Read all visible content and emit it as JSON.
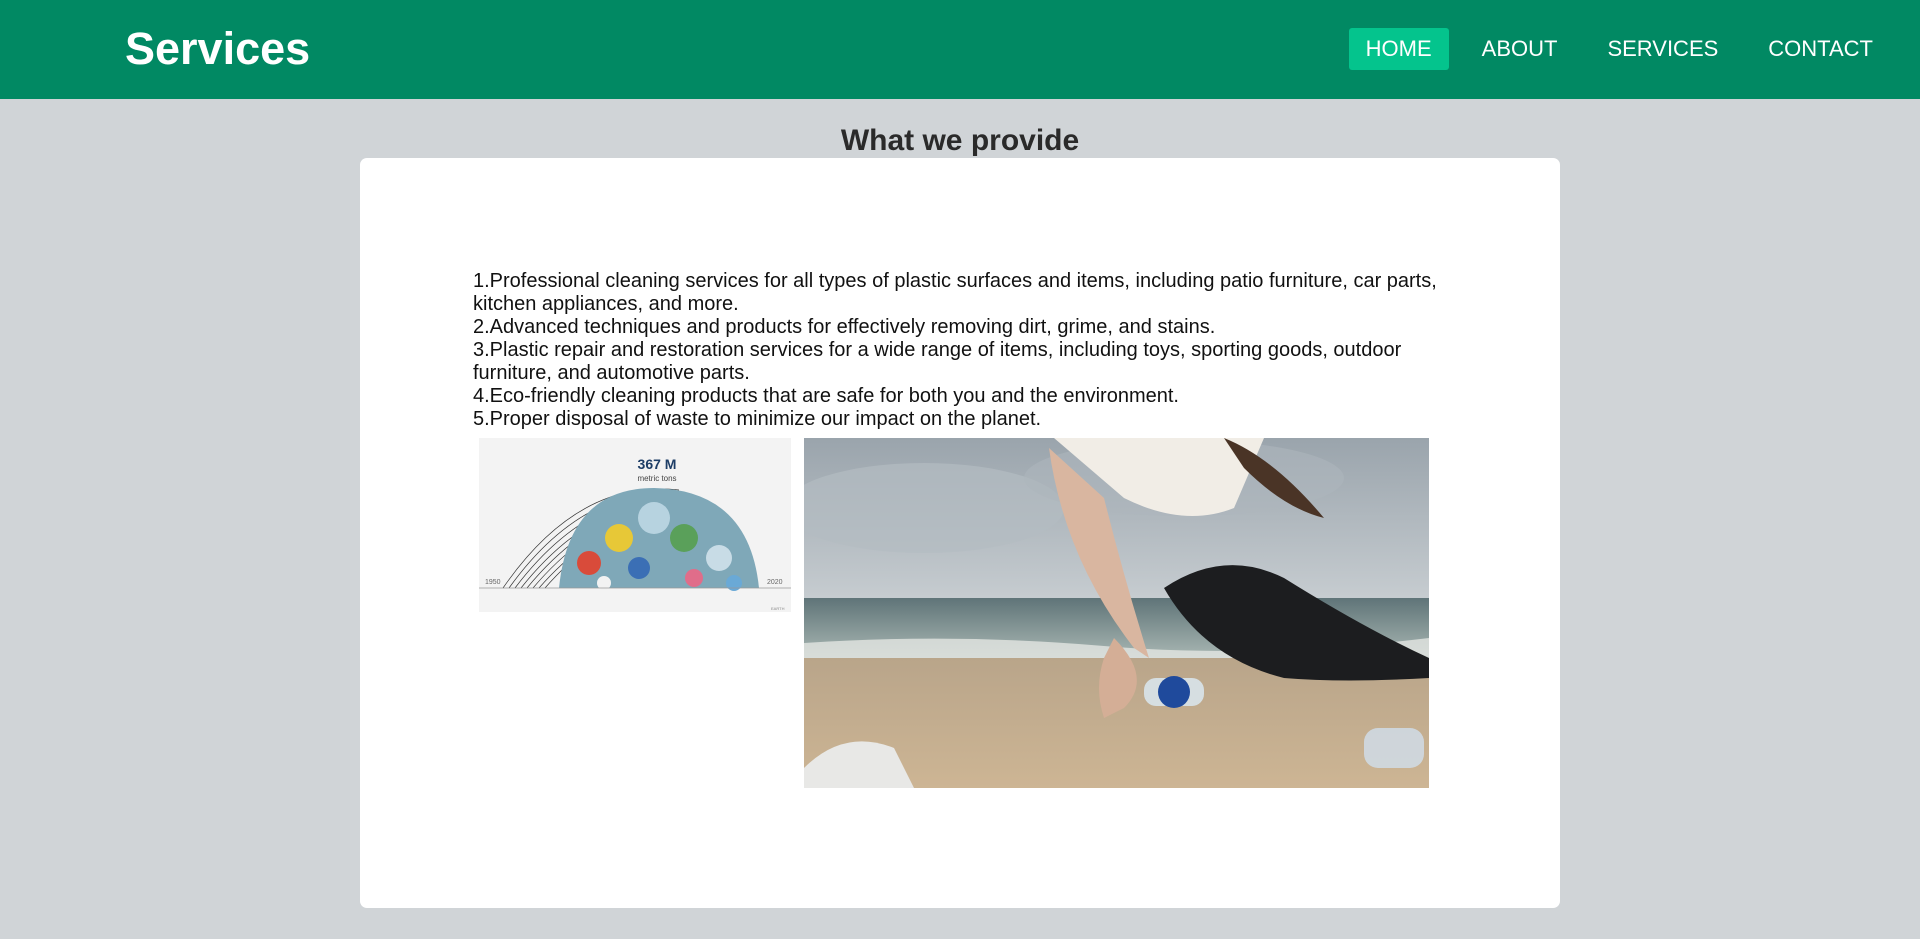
{
  "header": {
    "title": "Services",
    "nav": [
      "HOME",
      "ABOUT",
      "SERVICES",
      "CONTACT"
    ],
    "active_nav": "HOME"
  },
  "main": {
    "section_title": "What we provide",
    "list": [
      "1.Professional cleaning services for all types of plastic surfaces and items, including patio furniture, car parts, kitchen appliances, and more.",
      "2.Advanced techniques and products for effectively removing dirt, grime, and stains.",
      "3.Plastic repair and restoration services for a wide range of items, including toys, sporting goods, outdoor furniture, and automotive parts.",
      "4.Eco-friendly cleaning products that are safe for both you and the environment.",
      "5.Proper disposal of waste to minimize our impact on the planet."
    ],
    "chart_image": {
      "headline": "367 M",
      "unit": "metric tons",
      "year_start": "1950",
      "year_end": "2020",
      "credit": "EARTH"
    }
  },
  "colors": {
    "header_bg": "#018963",
    "nav_active_bg": "#04c48d",
    "page_bg": "#d0d4d7"
  }
}
